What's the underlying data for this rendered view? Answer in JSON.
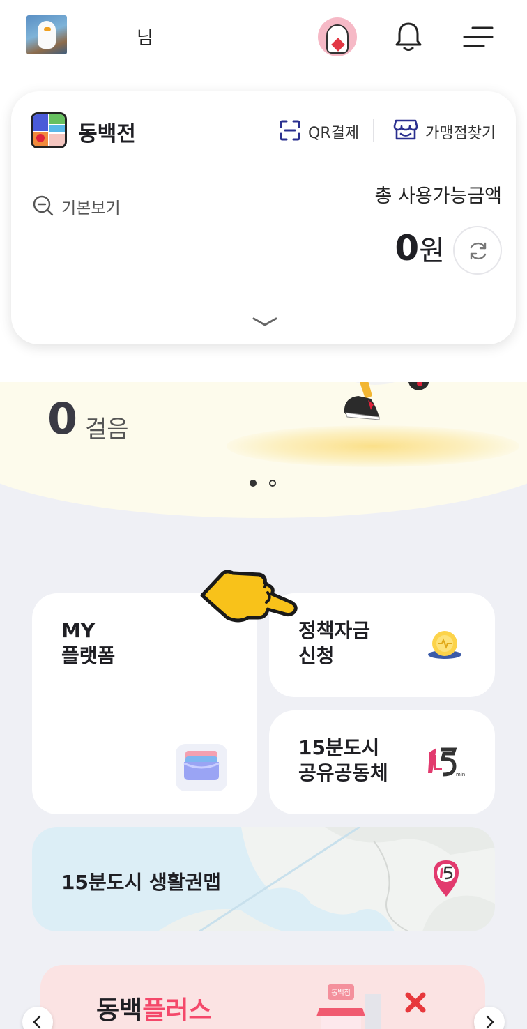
{
  "header": {
    "user_suffix": "님",
    "icons": [
      "profile-photo",
      "character-avatar",
      "bell-icon",
      "menu-icon"
    ]
  },
  "wallet": {
    "brand": "동백전",
    "qr_label": "QR결제",
    "store_label": "가맹점찾기",
    "view_label": "기본보기",
    "total_label": "총 사용가능금액",
    "amount_value": "0",
    "amount_unit": "원"
  },
  "steps": {
    "count": "0",
    "unit": "걸음",
    "pager": {
      "total": 2,
      "active": 1
    }
  },
  "tiles": {
    "my_platform": {
      "line1": "MY",
      "line2": "플랫폼"
    },
    "policy_fund": {
      "line1": "정책자금",
      "line2": "신청"
    },
    "city15": {
      "line1": "15분도시",
      "line2": "공유공동체"
    },
    "life_map": {
      "label": "15분도시 생활권맵"
    }
  },
  "banner": {
    "title_black": "동백",
    "title_red": "플러스",
    "shop_sign": "동백점"
  },
  "colors": {
    "background": "#eff0f5",
    "accent_red": "#f4486a",
    "steps_bg": "#fdfbec",
    "map_bg": "#dceef6"
  }
}
